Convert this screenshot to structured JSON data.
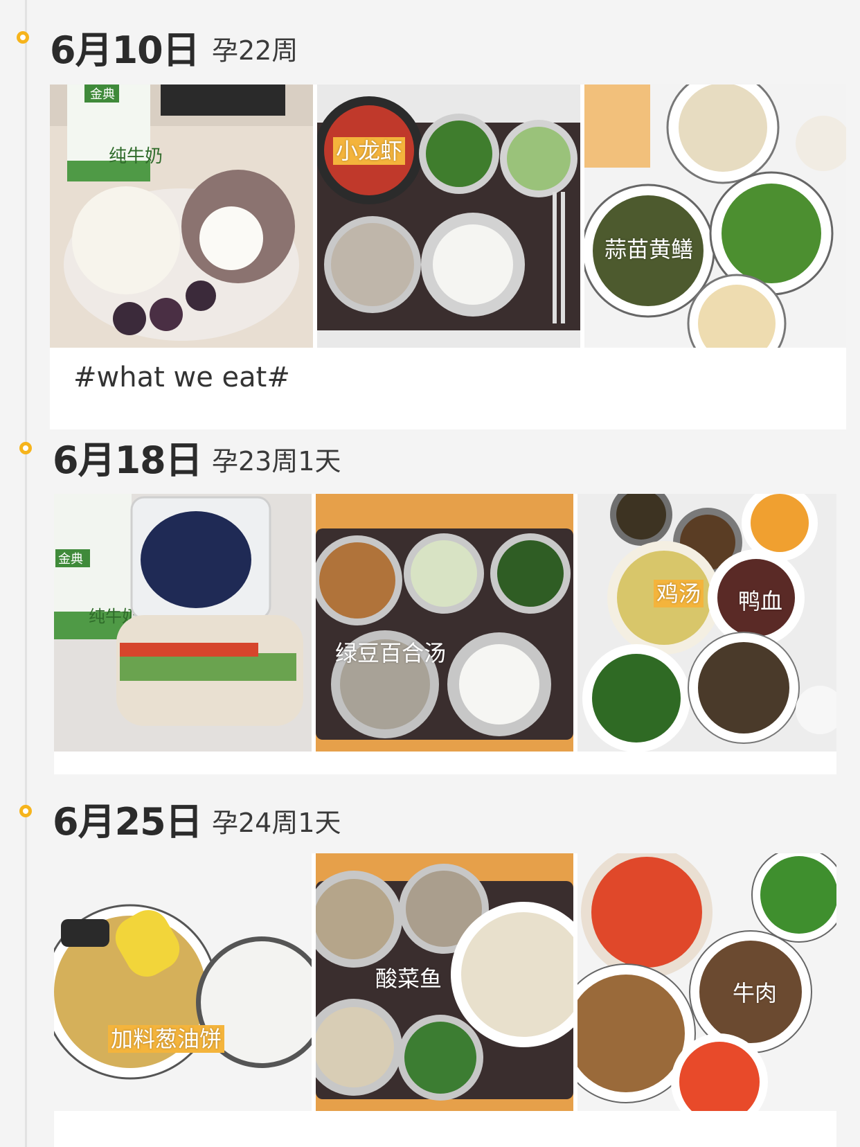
{
  "entries": [
    {
      "date": "6月10日",
      "week": "孕22周",
      "caption": "#what we eat#",
      "photos": [
        {
          "name": "breakfast",
          "tags": [],
          "milk_label": "纯牛奶",
          "brand_label": "金典"
        },
        {
          "name": "lunch",
          "tags": [
            {
              "text": "小龙虾",
              "style": "yellow"
            }
          ]
        },
        {
          "name": "dinner",
          "tags": [
            {
              "text": "蒜苗黄鳝",
              "style": "plain"
            }
          ]
        }
      ]
    },
    {
      "date": "6月18日",
      "week": "孕23周1天",
      "caption": "",
      "photos": [
        {
          "name": "breakfast",
          "tags": [],
          "milk_label": "纯牛奶",
          "brand_label": "金典"
        },
        {
          "name": "lunch",
          "tags": [
            {
              "text": "绿豆百合汤",
              "style": "plain"
            }
          ]
        },
        {
          "name": "dinner",
          "tags": [
            {
              "text": "鸡汤",
              "style": "yellow"
            },
            {
              "text": "鸭血",
              "style": "plain"
            }
          ]
        }
      ]
    },
    {
      "date": "6月25日",
      "week": "孕24周1天",
      "caption": "",
      "photos": [
        {
          "name": "breakfast",
          "tags": [
            {
              "text": "加料葱油饼",
              "style": "yellow"
            }
          ]
        },
        {
          "name": "lunch",
          "tags": [
            {
              "text": "酸菜鱼",
              "style": "plain"
            }
          ]
        },
        {
          "name": "dinner",
          "tags": [
            {
              "text": "牛肉",
              "style": "plain"
            }
          ]
        }
      ]
    }
  ],
  "colors": {
    "accent": "#f6b41c",
    "tag_bg": "#f4b43c",
    "background": "#f4f4f4"
  }
}
